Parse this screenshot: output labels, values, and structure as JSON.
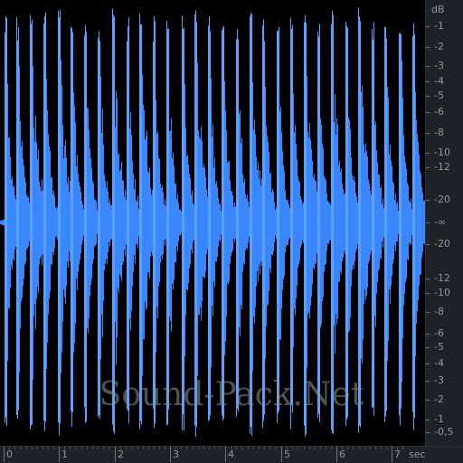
{
  "colors": {
    "waveform": "#3a86ff",
    "waveform_edge": "#5aa0ff",
    "background": "#000000",
    "ruler_bg": "#1e2226",
    "ruler_text": "#8e969e"
  },
  "db_ruler": {
    "unit": "dB",
    "top_labels": [
      "-1",
      "-2",
      "-3",
      "-4",
      "-5",
      "-6",
      "-8",
      "-10",
      "-12",
      "-20"
    ],
    "center_label": "-∞",
    "bottom_labels": [
      "-20",
      "-12",
      "-10",
      "-8",
      "-6",
      "-5",
      "-4",
      "-3",
      "-2",
      "-1",
      "-0,5"
    ]
  },
  "time_ruler": {
    "unit": "sec",
    "labels": [
      "0",
      "1",
      "2",
      "3",
      "4",
      "5",
      "6",
      "7"
    ]
  },
  "watermark": "Sound-Pack.Net",
  "waveform": {
    "hits_seconds": [
      0.02,
      0.24,
      0.48,
      0.73,
      0.98,
      1.22,
      1.46,
      1.71,
      1.96,
      2.22,
      2.46,
      2.7,
      2.95,
      3.22,
      3.45,
      3.69,
      3.94,
      4.2,
      4.44,
      4.68,
      4.93,
      5.18,
      5.42,
      5.67,
      5.91,
      6.17,
      6.4,
      6.64,
      6.88,
      7.14,
      7.38,
      7.62
    ],
    "strong_hits_seconds": [
      0.48,
      0.98,
      1.96,
      2.46,
      3.45,
      4.44,
      5.42,
      5.91,
      6.4
    ]
  }
}
